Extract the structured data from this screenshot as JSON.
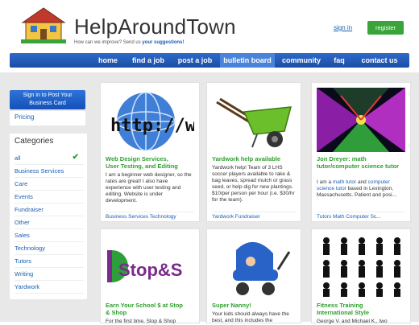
{
  "site": {
    "name": "HelpAroundTown",
    "tagline_text": "How can we improve? Send us",
    "tagline_link": "your suggestions!"
  },
  "auth": {
    "signin": "sign in",
    "register": "register"
  },
  "nav": {
    "items": [
      "home",
      "find a job",
      "post a job",
      "bulletin board",
      "community",
      "faq",
      "contact us"
    ],
    "active": "bulletin board"
  },
  "sidebar": {
    "post_button_line1": "Sign in to Post Your",
    "post_button_line2": "Business Card",
    "pricing": "Pricing",
    "categories_title": "Categories",
    "categories": [
      "all",
      "Business Services",
      "Care",
      "Events",
      "Fundraiser",
      "Other",
      "Sales",
      "Technology",
      "Tutors",
      "Writing",
      "Yardwork"
    ],
    "selected_category": "all"
  },
  "cards": [
    {
      "title_line1": "Web Design Services,",
      "title_line2": "User Testing, and Editing",
      "desc": "I am a beginner web designer, so the rates are great! I also have experience with user testing and editing. Website is under development.",
      "tags": "Business Services   Technology",
      "image": "globe-http-icon"
    },
    {
      "title_line1": "Yardwork help available",
      "title_line2": "",
      "desc": "Yardwork help! Team of 3 LHS soccer players available to rake & bag leaves, spread mulch or grass seed, or help dig for new plantings.  $10/per person per hour (i.e. $30/hr for the team).",
      "tags": "Yardwork   Fundraiser",
      "image": "wheelbarrow-icon"
    },
    {
      "title_line1": "Jon Dreyer: math",
      "title_line2": "tutor/computer science tutor",
      "desc_prefix": "I am a",
      "desc_link1": "math tutor",
      "desc_mid": "and",
      "desc_link2": "computer science tutor",
      "desc_suffix": "based in Lexington, Massachusetts. Patient and posi...",
      "tags": "Tutors   Math   Computer Sc...",
      "image": "fractal-image"
    },
    {
      "title_line1": "Earn Your School $ at Stop",
      "title_line2": "& Shop",
      "desc": "For the first time, Stop & Shop",
      "logo_text": "Stop&S",
      "image": "stop-and-shop-logo"
    },
    {
      "title_line1": "Super Nanny!",
      "title_line2": "",
      "desc": "Your kids should always have the best, and this includes the",
      "image": "baby-stroller-icon"
    },
    {
      "title_line1": "Fitness Training",
      "title_line2": "International Style",
      "desc": "George V. and Michael K., two",
      "image": "fitness-pictograms"
    }
  ]
}
